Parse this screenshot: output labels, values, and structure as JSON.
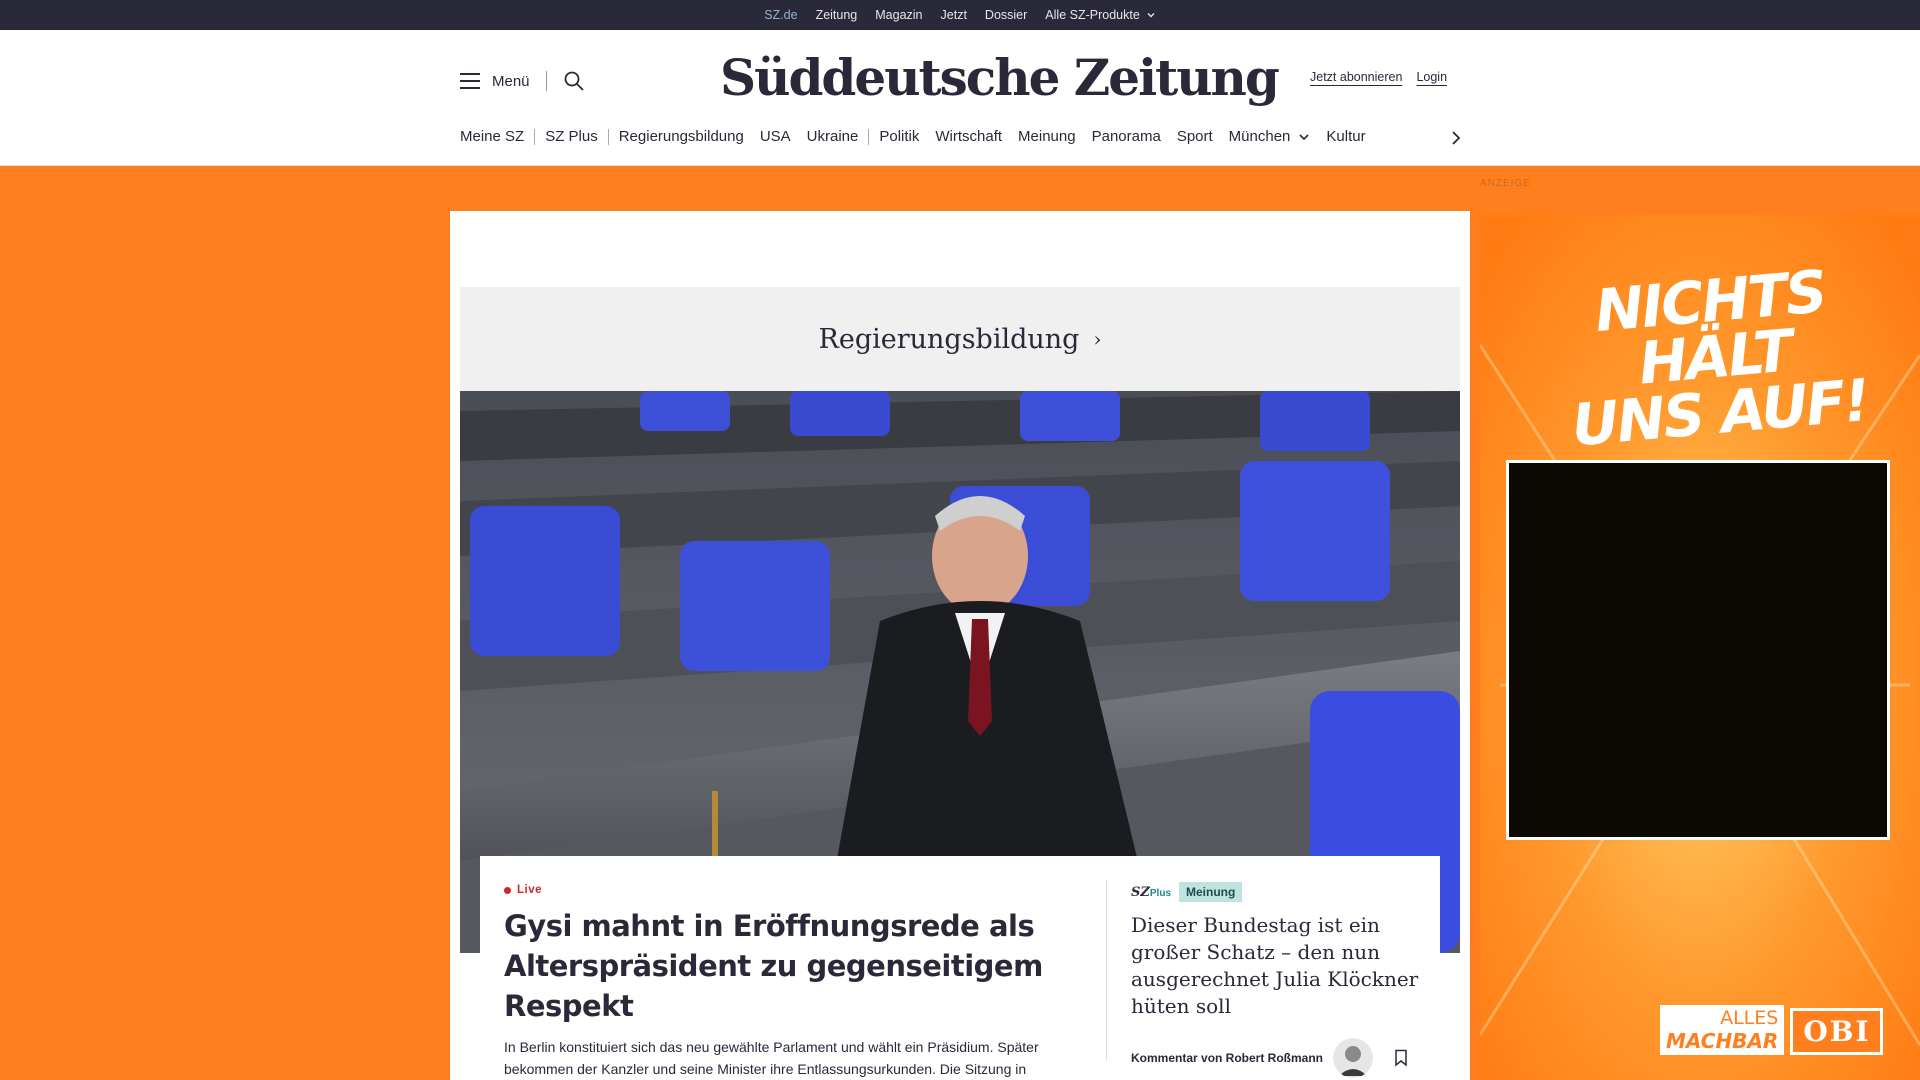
{
  "topbar": {
    "links": [
      "SZ.de",
      "Zeitung",
      "Magazin",
      "Jetzt",
      "Dossier",
      "Alle SZ-Produkte"
    ]
  },
  "header": {
    "menu_label": "Menü",
    "logo_text": "Süddeutsche Zeitung",
    "subscribe": "Jetzt abonnieren",
    "login": "Login"
  },
  "nav": {
    "items": [
      "Meine SZ",
      "SZ Plus",
      "Regierungsbildung",
      "USA",
      "Ukraine",
      "Politik",
      "Wirtschaft",
      "Meinung",
      "Panorama",
      "Sport",
      "München",
      "Kultur"
    ]
  },
  "ad_label": "ANZEIGE",
  "section": {
    "title": "Regierungsbildung",
    "chevron": "›"
  },
  "lead_story": {
    "label": "Live",
    "headline": "Gysi mahnt in Eröffnungsrede als Alterspräsident zu gegenseitigem Respekt",
    "lead": "In Berlin konstituiert sich das neu gewählte Parlament und wählt ein Präsidium. Später bekommen der Kanzler und seine Minister ihre Entlassungsurkunden. Die Sitzung in"
  },
  "opinion": {
    "brand": "SZ",
    "brand_suffix": "Plus",
    "badge": "Meinung",
    "title": "Dieser Bundestag ist ein großer Schatz – den nun ausgerechnet Julia Klöckner hüten soll",
    "byline": "Kommentar von Robert Roßmann"
  },
  "ad": {
    "headline_line1": "NICHTS HÄLT",
    "headline_line2": "UNS AUF!",
    "alles": "ALLES",
    "machbar": "MACHBAR",
    "brand": "OBI"
  },
  "colors": {
    "brand_dark": "#29293a",
    "ad_orange": "#ff7f1f",
    "live_red": "#d0262d",
    "opinion_badge": "#bfe3e0",
    "link_active": "#8fb6c8"
  }
}
